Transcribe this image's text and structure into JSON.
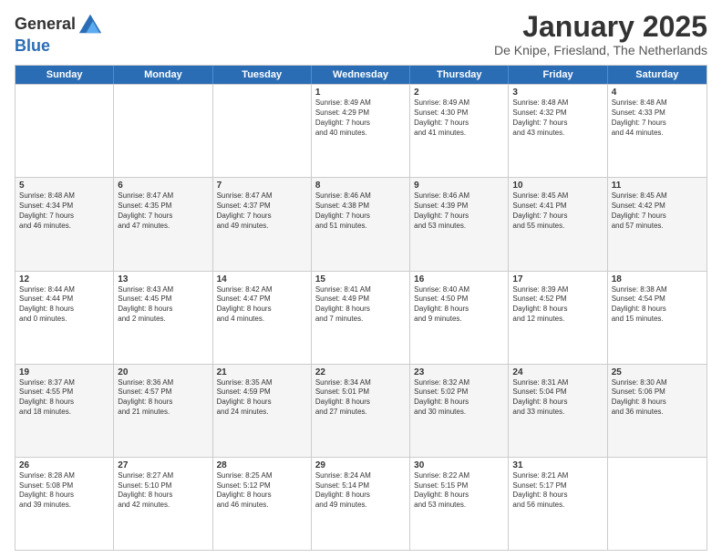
{
  "header": {
    "logo_general": "General",
    "logo_blue": "Blue",
    "month_title": "January 2025",
    "location": "De Knipe, Friesland, The Netherlands"
  },
  "weekdays": [
    "Sunday",
    "Monday",
    "Tuesday",
    "Wednesday",
    "Thursday",
    "Friday",
    "Saturday"
  ],
  "rows": [
    [
      {
        "day": "",
        "text": ""
      },
      {
        "day": "",
        "text": ""
      },
      {
        "day": "",
        "text": ""
      },
      {
        "day": "1",
        "text": "Sunrise: 8:49 AM\nSunset: 4:29 PM\nDaylight: 7 hours\nand 40 minutes."
      },
      {
        "day": "2",
        "text": "Sunrise: 8:49 AM\nSunset: 4:30 PM\nDaylight: 7 hours\nand 41 minutes."
      },
      {
        "day": "3",
        "text": "Sunrise: 8:48 AM\nSunset: 4:32 PM\nDaylight: 7 hours\nand 43 minutes."
      },
      {
        "day": "4",
        "text": "Sunrise: 8:48 AM\nSunset: 4:33 PM\nDaylight: 7 hours\nand 44 minutes."
      }
    ],
    [
      {
        "day": "5",
        "text": "Sunrise: 8:48 AM\nSunset: 4:34 PM\nDaylight: 7 hours\nand 46 minutes."
      },
      {
        "day": "6",
        "text": "Sunrise: 8:47 AM\nSunset: 4:35 PM\nDaylight: 7 hours\nand 47 minutes."
      },
      {
        "day": "7",
        "text": "Sunrise: 8:47 AM\nSunset: 4:37 PM\nDaylight: 7 hours\nand 49 minutes."
      },
      {
        "day": "8",
        "text": "Sunrise: 8:46 AM\nSunset: 4:38 PM\nDaylight: 7 hours\nand 51 minutes."
      },
      {
        "day": "9",
        "text": "Sunrise: 8:46 AM\nSunset: 4:39 PM\nDaylight: 7 hours\nand 53 minutes."
      },
      {
        "day": "10",
        "text": "Sunrise: 8:45 AM\nSunset: 4:41 PM\nDaylight: 7 hours\nand 55 minutes."
      },
      {
        "day": "11",
        "text": "Sunrise: 8:45 AM\nSunset: 4:42 PM\nDaylight: 7 hours\nand 57 minutes."
      }
    ],
    [
      {
        "day": "12",
        "text": "Sunrise: 8:44 AM\nSunset: 4:44 PM\nDaylight: 8 hours\nand 0 minutes."
      },
      {
        "day": "13",
        "text": "Sunrise: 8:43 AM\nSunset: 4:45 PM\nDaylight: 8 hours\nand 2 minutes."
      },
      {
        "day": "14",
        "text": "Sunrise: 8:42 AM\nSunset: 4:47 PM\nDaylight: 8 hours\nand 4 minutes."
      },
      {
        "day": "15",
        "text": "Sunrise: 8:41 AM\nSunset: 4:49 PM\nDaylight: 8 hours\nand 7 minutes."
      },
      {
        "day": "16",
        "text": "Sunrise: 8:40 AM\nSunset: 4:50 PM\nDaylight: 8 hours\nand 9 minutes."
      },
      {
        "day": "17",
        "text": "Sunrise: 8:39 AM\nSunset: 4:52 PM\nDaylight: 8 hours\nand 12 minutes."
      },
      {
        "day": "18",
        "text": "Sunrise: 8:38 AM\nSunset: 4:54 PM\nDaylight: 8 hours\nand 15 minutes."
      }
    ],
    [
      {
        "day": "19",
        "text": "Sunrise: 8:37 AM\nSunset: 4:55 PM\nDaylight: 8 hours\nand 18 minutes."
      },
      {
        "day": "20",
        "text": "Sunrise: 8:36 AM\nSunset: 4:57 PM\nDaylight: 8 hours\nand 21 minutes."
      },
      {
        "day": "21",
        "text": "Sunrise: 8:35 AM\nSunset: 4:59 PM\nDaylight: 8 hours\nand 24 minutes."
      },
      {
        "day": "22",
        "text": "Sunrise: 8:34 AM\nSunset: 5:01 PM\nDaylight: 8 hours\nand 27 minutes."
      },
      {
        "day": "23",
        "text": "Sunrise: 8:32 AM\nSunset: 5:02 PM\nDaylight: 8 hours\nand 30 minutes."
      },
      {
        "day": "24",
        "text": "Sunrise: 8:31 AM\nSunset: 5:04 PM\nDaylight: 8 hours\nand 33 minutes."
      },
      {
        "day": "25",
        "text": "Sunrise: 8:30 AM\nSunset: 5:06 PM\nDaylight: 8 hours\nand 36 minutes."
      }
    ],
    [
      {
        "day": "26",
        "text": "Sunrise: 8:28 AM\nSunset: 5:08 PM\nDaylight: 8 hours\nand 39 minutes."
      },
      {
        "day": "27",
        "text": "Sunrise: 8:27 AM\nSunset: 5:10 PM\nDaylight: 8 hours\nand 42 minutes."
      },
      {
        "day": "28",
        "text": "Sunrise: 8:25 AM\nSunset: 5:12 PM\nDaylight: 8 hours\nand 46 minutes."
      },
      {
        "day": "29",
        "text": "Sunrise: 8:24 AM\nSunset: 5:14 PM\nDaylight: 8 hours\nand 49 minutes."
      },
      {
        "day": "30",
        "text": "Sunrise: 8:22 AM\nSunset: 5:15 PM\nDaylight: 8 hours\nand 53 minutes."
      },
      {
        "day": "31",
        "text": "Sunrise: 8:21 AM\nSunset: 5:17 PM\nDaylight: 8 hours\nand 56 minutes."
      },
      {
        "day": "",
        "text": ""
      }
    ]
  ]
}
